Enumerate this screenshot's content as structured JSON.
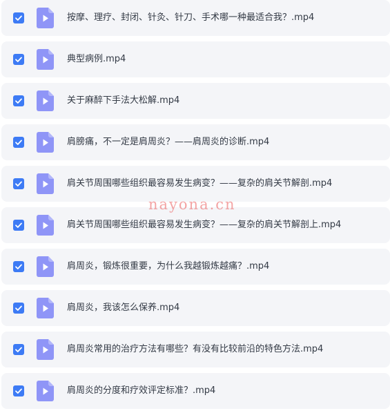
{
  "colors": {
    "row_background": "#f4f5f8",
    "checkbox": "#3d7bf5",
    "file_icon": "#8f95f7",
    "text": "#333a45",
    "watermark": "#eb5a5a"
  },
  "icons": {
    "checkbox": "checkbox-checked-icon",
    "file": "video-file-play-icon"
  },
  "files": [
    {
      "name": "按摩、理疗、封闭、针灸、针刀、手术哪一种最适合我？.mp4",
      "checked": true
    },
    {
      "name": "典型病例.mp4",
      "checked": true
    },
    {
      "name": "关于麻醉下手法大松解.mp4",
      "checked": true
    },
    {
      "name": "肩膀痛，不一定是肩周炎？——肩周炎的诊断.mp4",
      "checked": true
    },
    {
      "name": "肩关节周围哪些组织最容易发生病变？——复杂的肩关节解剖.mp4",
      "checked": true
    },
    {
      "name": "肩关节周围哪些组织最容易发生病变？——复杂的肩关节解剖上.mp4",
      "checked": true
    },
    {
      "name": "肩周炎，锻炼很重要，为什么我越锻炼越痛？.mp4",
      "checked": true
    },
    {
      "name": "肩周炎，我该怎么保养.mp4",
      "checked": true
    },
    {
      "name": "肩周炎常用的治疗方法有哪些？有没有比较前沿的特色方法.mp4",
      "checked": true
    },
    {
      "name": "肩周炎的分度和疗效评定标准？.mp4",
      "checked": true
    }
  ],
  "watermark": {
    "text": "nayona.cn"
  }
}
